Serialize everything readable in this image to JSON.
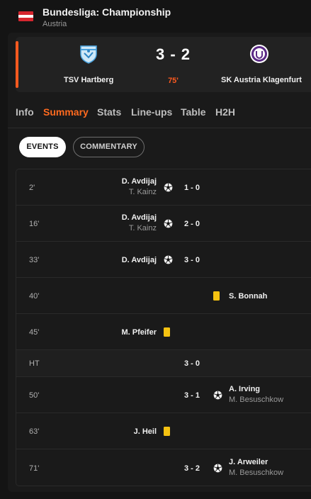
{
  "league": {
    "name": "Bundesliga: Championship",
    "country": "Austria"
  },
  "match": {
    "home_team": "TSV Hartberg",
    "away_team": "SK Austria Klagenfurt",
    "score": "3 - 2",
    "minute": "75'"
  },
  "colors": {
    "accent": "#ff6a1f",
    "yellow_card": "#f5c211",
    "flag_red": "#d6262f"
  },
  "tabs": [
    {
      "label": "Info",
      "active": false
    },
    {
      "label": "Summary",
      "active": true
    },
    {
      "label": "Stats",
      "active": false
    },
    {
      "label": "Line-ups",
      "active": false
    },
    {
      "label": "Table",
      "active": false
    },
    {
      "label": "H2H",
      "active": false
    }
  ],
  "filters": {
    "events": "EVENTS",
    "commentary": "COMMENTARY",
    "selected": "EVENTS"
  },
  "events": [
    {
      "minute": "2'",
      "side": "home",
      "type": "goal",
      "player": "D. Avdijaj",
      "assist": "T. Kainz",
      "score": "1 - 0"
    },
    {
      "minute": "16'",
      "side": "home",
      "type": "goal",
      "player": "D. Avdijaj",
      "assist": "T. Kainz",
      "score": "2 - 0"
    },
    {
      "minute": "33'",
      "side": "home",
      "type": "goal",
      "player": "D. Avdijaj",
      "assist": "",
      "score": "3 - 0"
    },
    {
      "minute": "40'",
      "side": "away",
      "type": "yellow",
      "player": "S. Bonnah",
      "assist": "",
      "score": ""
    },
    {
      "minute": "45'",
      "side": "home",
      "type": "yellow",
      "player": "M. Pfeifer",
      "assist": "",
      "score": ""
    },
    {
      "minute": "HT",
      "side": "none",
      "type": "halftime",
      "player": "",
      "assist": "",
      "score": "3 - 0"
    },
    {
      "minute": "50'",
      "side": "away",
      "type": "goal",
      "player": "A. Irving",
      "assist": "M. Besuschkow",
      "score": "3 - 1"
    },
    {
      "minute": "63'",
      "side": "home",
      "type": "yellow",
      "player": "J. Heil",
      "assist": "",
      "score": ""
    },
    {
      "minute": "71'",
      "side": "away",
      "type": "goal",
      "player": "J. Arweiler",
      "assist": "M. Besuschkow",
      "score": "3 - 2"
    }
  ]
}
